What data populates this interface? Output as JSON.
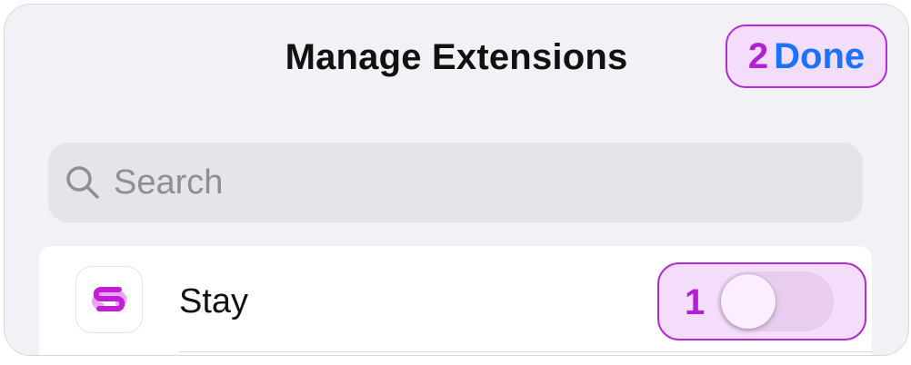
{
  "header": {
    "title": "Manage Extensions",
    "done_badge": "2",
    "done_label": "Done"
  },
  "search": {
    "placeholder": "Search",
    "value": ""
  },
  "extensions": [
    {
      "name": "Stay",
      "icon": "stay-app-icon",
      "toggle_badge": "1",
      "enabled": false
    }
  ],
  "colors": {
    "accent_blue": "#1a73ff",
    "highlight_purple": "#b12bd6",
    "highlight_fill": "#f4dcfb",
    "stay_icon_magenta": "#c21ed8"
  }
}
